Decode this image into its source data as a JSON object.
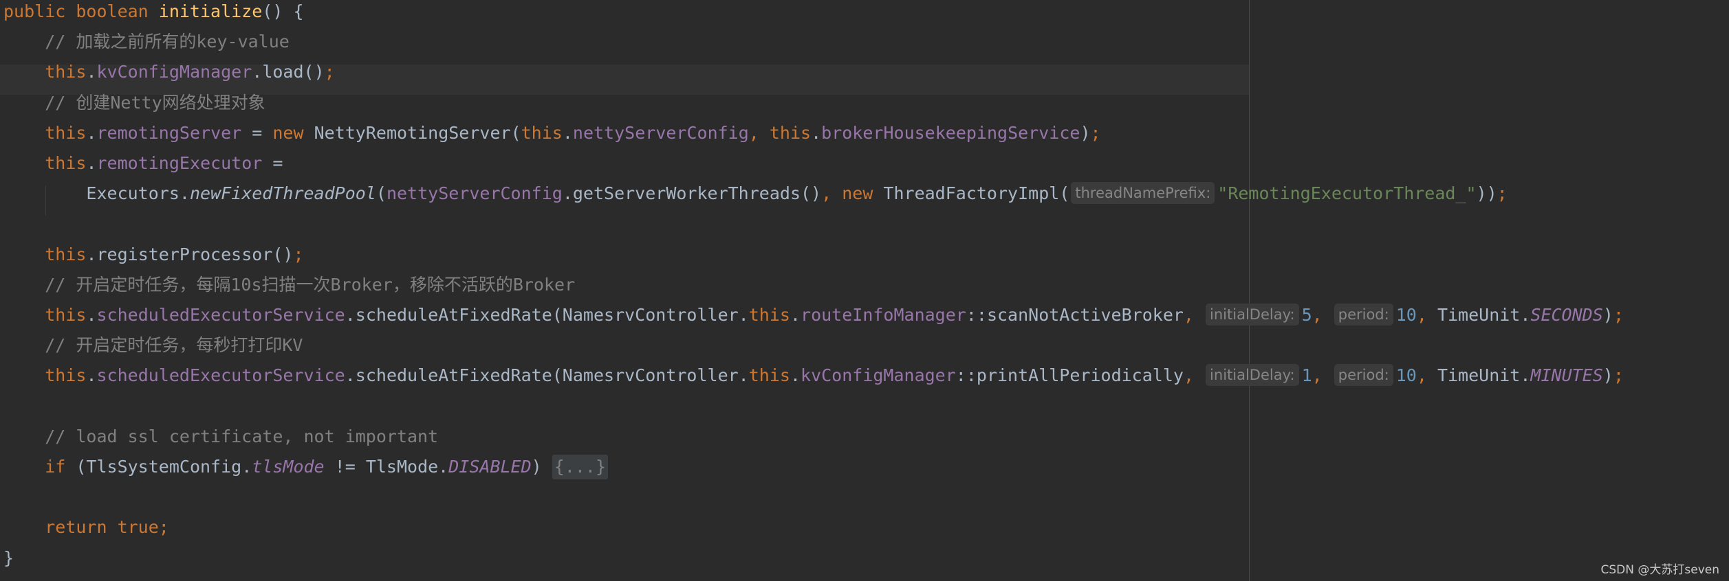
{
  "editor": {
    "watermark": "CSDN @大苏打seven",
    "lines": [
      {
        "id": "line-01",
        "tokens": [
          {
            "c": "kw",
            "t": "public "
          },
          {
            "c": "kw",
            "t": "boolean "
          },
          {
            "c": "method-decl",
            "t": "initialize"
          },
          {
            "c": "punc",
            "t": "() {"
          }
        ]
      },
      {
        "id": "line-02",
        "tokens": [
          {
            "c": "comment",
            "t": "    // 加载之前所有的key-value"
          }
        ]
      },
      {
        "id": "line-03",
        "tokens": [
          {
            "c": "punc",
            "t": "    "
          },
          {
            "c": "kw",
            "t": "this"
          },
          {
            "c": "punc",
            "t": "."
          },
          {
            "c": "field",
            "t": "kvConfigManager"
          },
          {
            "c": "punc",
            "t": ".load()"
          },
          {
            "c": "kw",
            "t": ";"
          }
        ]
      },
      {
        "id": "line-04",
        "tokens": [
          {
            "c": "comment",
            "t": "    // 创建Netty网络处理对象"
          }
        ]
      },
      {
        "id": "line-05",
        "tokens": [
          {
            "c": "punc",
            "t": "    "
          },
          {
            "c": "kw",
            "t": "this"
          },
          {
            "c": "punc",
            "t": "."
          },
          {
            "c": "field",
            "t": "remotingServer"
          },
          {
            "c": "punc",
            "t": " = "
          },
          {
            "c": "kw",
            "t": "new "
          },
          {
            "c": "punc",
            "t": "NettyRemotingServer("
          },
          {
            "c": "kw",
            "t": "this"
          },
          {
            "c": "punc",
            "t": "."
          },
          {
            "c": "field",
            "t": "nettyServerConfig"
          },
          {
            "c": "kw",
            "t": ", this"
          },
          {
            "c": "punc",
            "t": "."
          },
          {
            "c": "field",
            "t": "brokerHousekeepingService"
          },
          {
            "c": "punc",
            "t": ")"
          },
          {
            "c": "kw",
            "t": ";"
          }
        ]
      },
      {
        "id": "line-06",
        "tokens": [
          {
            "c": "punc",
            "t": "    "
          },
          {
            "c": "kw",
            "t": "this"
          },
          {
            "c": "punc",
            "t": "."
          },
          {
            "c": "field",
            "t": "remotingExecutor"
          },
          {
            "c": "punc",
            "t": " ="
          }
        ]
      },
      {
        "id": "line-07",
        "tokens": [
          {
            "c": "punc",
            "t": "        Executors."
          },
          {
            "c": "method-static-italic",
            "t": "newFixedThreadPool"
          },
          {
            "c": "punc",
            "t": "("
          },
          {
            "c": "field",
            "t": "nettyServerConfig"
          },
          {
            "c": "punc",
            "t": ".getServerWorkerThreads()"
          },
          {
            "c": "kw",
            "t": ", new "
          },
          {
            "c": "punc",
            "t": "ThreadFactoryImpl("
          },
          {
            "c": "hint",
            "t": "threadNamePrefix:"
          },
          {
            "c": "string",
            "t": "\"RemotingExecutorThread_\""
          },
          {
            "c": "punc",
            "t": "))"
          },
          {
            "c": "kw",
            "t": ";"
          }
        ]
      },
      {
        "id": "line-08",
        "tokens": []
      },
      {
        "id": "line-09",
        "tokens": [
          {
            "c": "punc",
            "t": "    "
          },
          {
            "c": "kw",
            "t": "this"
          },
          {
            "c": "punc",
            "t": ".registerProcessor()"
          },
          {
            "c": "kw",
            "t": ";"
          }
        ]
      },
      {
        "id": "line-10",
        "tokens": [
          {
            "c": "comment",
            "t": "    // 开启定时任务，每隔10s扫描一次Broker，移除不活跃的Broker"
          }
        ]
      },
      {
        "id": "line-11",
        "tokens": [
          {
            "c": "punc",
            "t": "    "
          },
          {
            "c": "kw",
            "t": "this"
          },
          {
            "c": "punc",
            "t": "."
          },
          {
            "c": "field",
            "t": "scheduledExecutorService"
          },
          {
            "c": "punc",
            "t": ".scheduleAtFixedRate(NamesrvController."
          },
          {
            "c": "kw",
            "t": "this"
          },
          {
            "c": "punc",
            "t": "."
          },
          {
            "c": "field",
            "t": "routeInfoManager"
          },
          {
            "c": "punc",
            "t": "::scanNotActiveBroker"
          },
          {
            "c": "kw",
            "t": ", "
          },
          {
            "c": "hint",
            "t": "initialDelay:"
          },
          {
            "c": "number",
            "t": "5"
          },
          {
            "c": "kw",
            "t": ", "
          },
          {
            "c": "hint",
            "t": "period:"
          },
          {
            "c": "number",
            "t": "10"
          },
          {
            "c": "kw",
            "t": ", "
          },
          {
            "c": "punc",
            "t": "TimeUnit."
          },
          {
            "c": "field-static-italic",
            "t": "SECONDS"
          },
          {
            "c": "punc",
            "t": ")"
          },
          {
            "c": "kw",
            "t": ";"
          }
        ]
      },
      {
        "id": "line-12",
        "tokens": [
          {
            "c": "comment",
            "t": "    // 开启定时任务，每秒打打印KV"
          }
        ]
      },
      {
        "id": "line-13",
        "tokens": [
          {
            "c": "punc",
            "t": "    "
          },
          {
            "c": "kw",
            "t": "this"
          },
          {
            "c": "punc",
            "t": "."
          },
          {
            "c": "field",
            "t": "scheduledExecutorService"
          },
          {
            "c": "punc",
            "t": ".scheduleAtFixedRate(NamesrvController."
          },
          {
            "c": "kw",
            "t": "this"
          },
          {
            "c": "punc",
            "t": "."
          },
          {
            "c": "field",
            "t": "kvConfigManager"
          },
          {
            "c": "punc",
            "t": "::printAllPeriodically"
          },
          {
            "c": "kw",
            "t": ", "
          },
          {
            "c": "hint",
            "t": "initialDelay:"
          },
          {
            "c": "number",
            "t": "1"
          },
          {
            "c": "kw",
            "t": ", "
          },
          {
            "c": "hint",
            "t": "period:"
          },
          {
            "c": "number",
            "t": "10"
          },
          {
            "c": "kw",
            "t": ", "
          },
          {
            "c": "punc",
            "t": "TimeUnit."
          },
          {
            "c": "field-static-italic",
            "t": "MINUTES"
          },
          {
            "c": "punc",
            "t": ")"
          },
          {
            "c": "kw",
            "t": ";"
          }
        ]
      },
      {
        "id": "line-14",
        "tokens": []
      },
      {
        "id": "line-15",
        "tokens": [
          {
            "c": "comment",
            "t": "    // load ssl certificate, not important"
          }
        ]
      },
      {
        "id": "line-16",
        "tokens": [
          {
            "c": "punc",
            "t": "    "
          },
          {
            "c": "kw",
            "t": "if "
          },
          {
            "c": "punc",
            "t": "(TlsSystemConfig."
          },
          {
            "c": "field-static-italic",
            "t": "tlsMode"
          },
          {
            "c": "punc",
            "t": " != TlsMode."
          },
          {
            "c": "field-static-italic",
            "t": "DISABLED"
          },
          {
            "c": "punc",
            "t": ") "
          },
          {
            "c": "fold",
            "t": "{...}"
          }
        ]
      },
      {
        "id": "line-17",
        "tokens": []
      },
      {
        "id": "line-18",
        "tokens": [
          {
            "c": "punc",
            "t": "    "
          },
          {
            "c": "kw",
            "t": "return true;"
          }
        ]
      },
      {
        "id": "line-19",
        "tokens": [
          {
            "c": "punc",
            "t": "}"
          }
        ]
      }
    ]
  }
}
